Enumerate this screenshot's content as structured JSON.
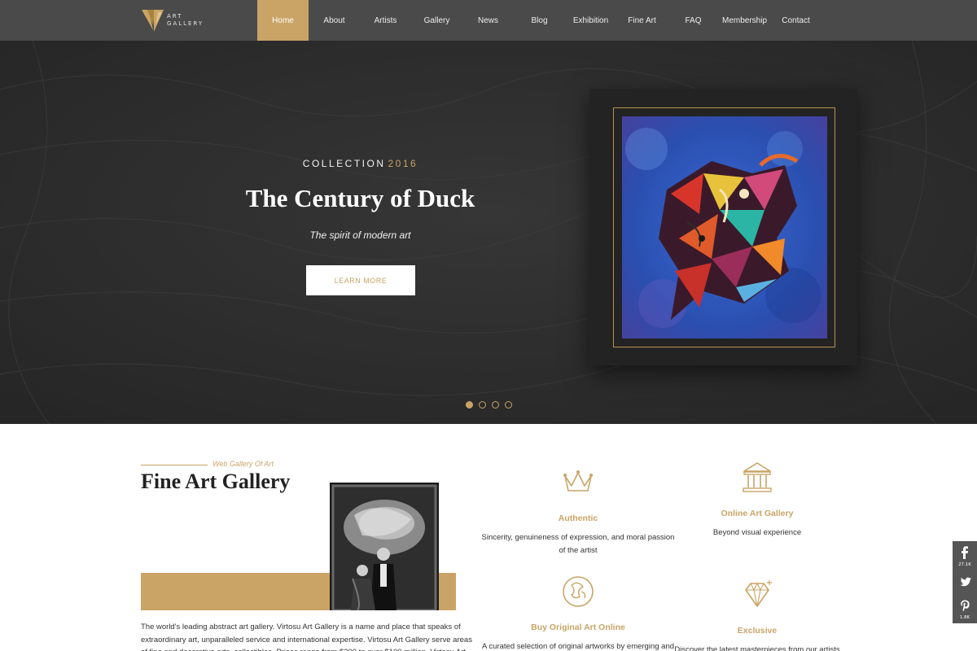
{
  "brand": {
    "logo_text_top": "ART",
    "logo_text_bottom": "GALLERY",
    "accent": "#c9a466"
  },
  "nav": {
    "items": [
      {
        "label": "Home",
        "active": true
      },
      {
        "label": "About"
      },
      {
        "label": "Artists"
      },
      {
        "label": "Gallery"
      },
      {
        "label": "News"
      },
      {
        "label": "Blog"
      },
      {
        "label": "Exhibition"
      },
      {
        "label": "Fine Art"
      },
      {
        "label": "FAQ"
      },
      {
        "label": "Membership"
      },
      {
        "label": "Contact"
      }
    ]
  },
  "hero": {
    "eyebrow": "COLLECTION",
    "year": "2016",
    "title": "The Century of Duck",
    "subtitle": "The spirit of modern art",
    "button": "LEARN MORE",
    "slides": 4,
    "active_slide": 1
  },
  "about": {
    "kicker": "Web Gallery Of Art",
    "title": "Fine Art Gallery",
    "text": "The world's leading abstract art gallery. Virtosu Art Gallery is a name and place that speaks of extraordinary art, unparalleled service and international expertise. Virtosu Art Gallery serve areas of fine and decorative arts, collectibles. Prices range from $200 to over $100 million. Virtosu Art Gallery"
  },
  "features": [
    {
      "icon": "crown-icon",
      "title": "Authentic",
      "desc": "Sincerity, genuineness of expression, and moral passion of the artist"
    },
    {
      "icon": "museum-icon",
      "title": "Online Art Gallery",
      "desc": "Beyond visual experience"
    },
    {
      "icon": "art-face-icon",
      "title": "Buy Original Art Online",
      "desc": "A curated selection of original artworks by emerging and established"
    },
    {
      "icon": "diamond-icon",
      "title": "Exclusive",
      "desc": "Discover the latest masterpieces from our artists"
    }
  ],
  "social": {
    "facebook_count": "27.1K",
    "pinterest_count": "1.8K"
  }
}
